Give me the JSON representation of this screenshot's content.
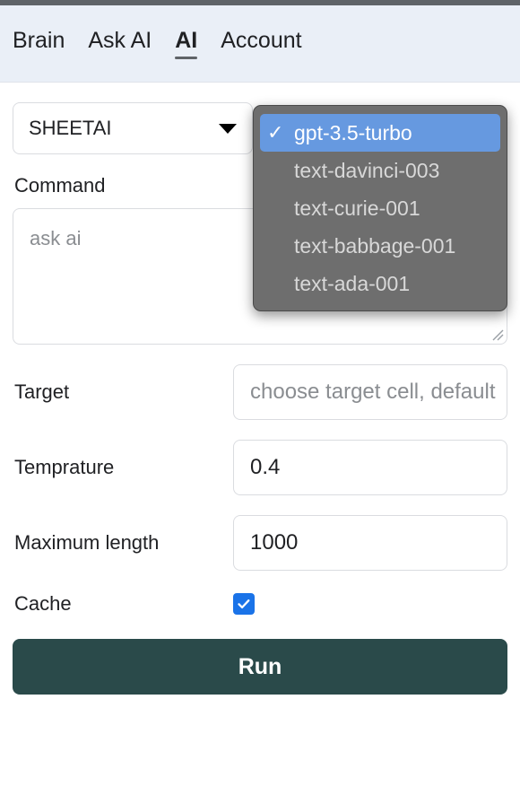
{
  "window": {
    "top_strip_color": "#5f6368"
  },
  "navbar": {
    "background_color": "#eaeff7",
    "tabs": [
      {
        "label": "Brain",
        "active": false
      },
      {
        "label": "Ask AI",
        "active": false
      },
      {
        "label": "AI",
        "active": true
      },
      {
        "label": "Account",
        "active": false
      }
    ]
  },
  "form": {
    "provider_select": {
      "value": "SHEETAI",
      "caret_icon": "chevron-down-icon"
    },
    "command": {
      "label": "Command",
      "placeholder": "ask ai",
      "value": ""
    },
    "target": {
      "label": "Target",
      "placeholder": "choose target cell, default",
      "value": ""
    },
    "temperature": {
      "label": "Temprature",
      "value": "0.4"
    },
    "maximum_length": {
      "label": "Maximum length",
      "value": "1000"
    },
    "cache": {
      "label": "Cache",
      "checked": true,
      "accent_color": "#1a73e8"
    },
    "run_button": {
      "label": "Run",
      "background_color": "#2a4a4a"
    }
  },
  "model_menu": {
    "open": true,
    "selected": "gpt-3.5-turbo",
    "check_glyph": "✓",
    "highlight_color": "#6699e0",
    "background_color": "#6e6e6e",
    "items": [
      {
        "label": "gpt-3.5-turbo",
        "selected": true
      },
      {
        "label": "text-davinci-003",
        "selected": false
      },
      {
        "label": "text-curie-001",
        "selected": false
      },
      {
        "label": "text-babbage-001",
        "selected": false
      },
      {
        "label": "text-ada-001",
        "selected": false
      }
    ]
  }
}
